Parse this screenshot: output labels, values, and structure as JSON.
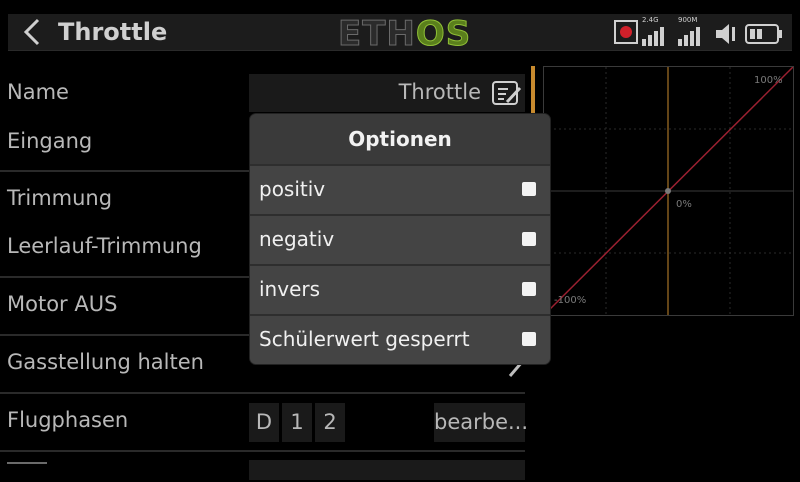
{
  "header": {
    "title": "Throttle",
    "logo_part1": "ETH",
    "logo_part2": "OS",
    "radio_band": "2.4G",
    "radio_band2": "900M"
  },
  "form": {
    "name_label": "Name",
    "name_value": "Throttle",
    "eingang_label": "Eingang",
    "trimmung_label": "Trimmung",
    "leerlauf_label": "Leerlauf-Trimmung",
    "motor_label": "Motor AUS",
    "gas_label": "Gasstellung halten",
    "flugphasen_label": "Flugphasen",
    "flugphasen_chips": [
      "D",
      "1",
      "2"
    ],
    "edit_label": "bearbe..."
  },
  "chart": {
    "label_top": "100%",
    "label_mid": "0%",
    "label_bottom": "-100%"
  },
  "dialog": {
    "title": "Optionen",
    "options": [
      {
        "label": "positiv",
        "checked": false
      },
      {
        "label": "negativ",
        "checked": false
      },
      {
        "label": "invers",
        "checked": false
      },
      {
        "label": "Schülerwert gesperrt",
        "checked": false
      }
    ]
  },
  "colors": {
    "accent": "#c78a2e",
    "curve": "#9b2030",
    "logo_green": "#8fbf36"
  }
}
